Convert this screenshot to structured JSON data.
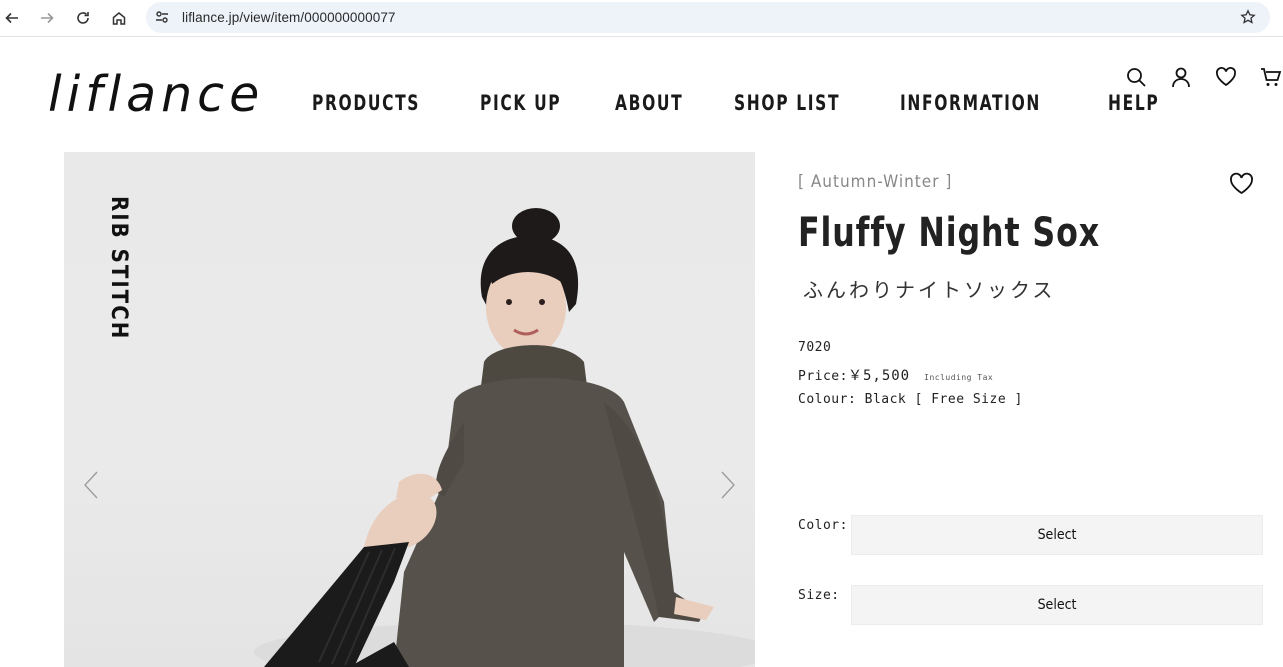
{
  "browser": {
    "url": "liflance.jp/view/item/000000000077"
  },
  "site": {
    "logo": "liflance",
    "nav": [
      "PRODUCTS",
      "PICK UP",
      "ABOUT",
      "SHOP LIST",
      "INFORMATION",
      "HELP"
    ],
    "header_icons": [
      "search-icon",
      "account-icon",
      "wishlist-icon",
      "cart-icon"
    ]
  },
  "gallery": {
    "overlay_text": "RIB STITCH",
    "prev_icon": "chevron-left-icon",
    "next_icon": "chevron-right-icon"
  },
  "product": {
    "season": "[ Autumn-Winter ]",
    "name": "Fluffy Night Sox",
    "name_jp": "ふんわりナイトソックス",
    "code": "7020",
    "price_label": "Price:",
    "price_value": "￥5,500",
    "tax_note": "Including Tax",
    "colour_line": "Colour: Black [ Free Size ]"
  },
  "options": {
    "color_label": "Color:",
    "color_value": "Select",
    "size_label": "Size:",
    "size_value": "Select"
  },
  "colors": {
    "accent": "#222222",
    "select_bg": "#f4f4f4",
    "season_gray": "#888888"
  }
}
